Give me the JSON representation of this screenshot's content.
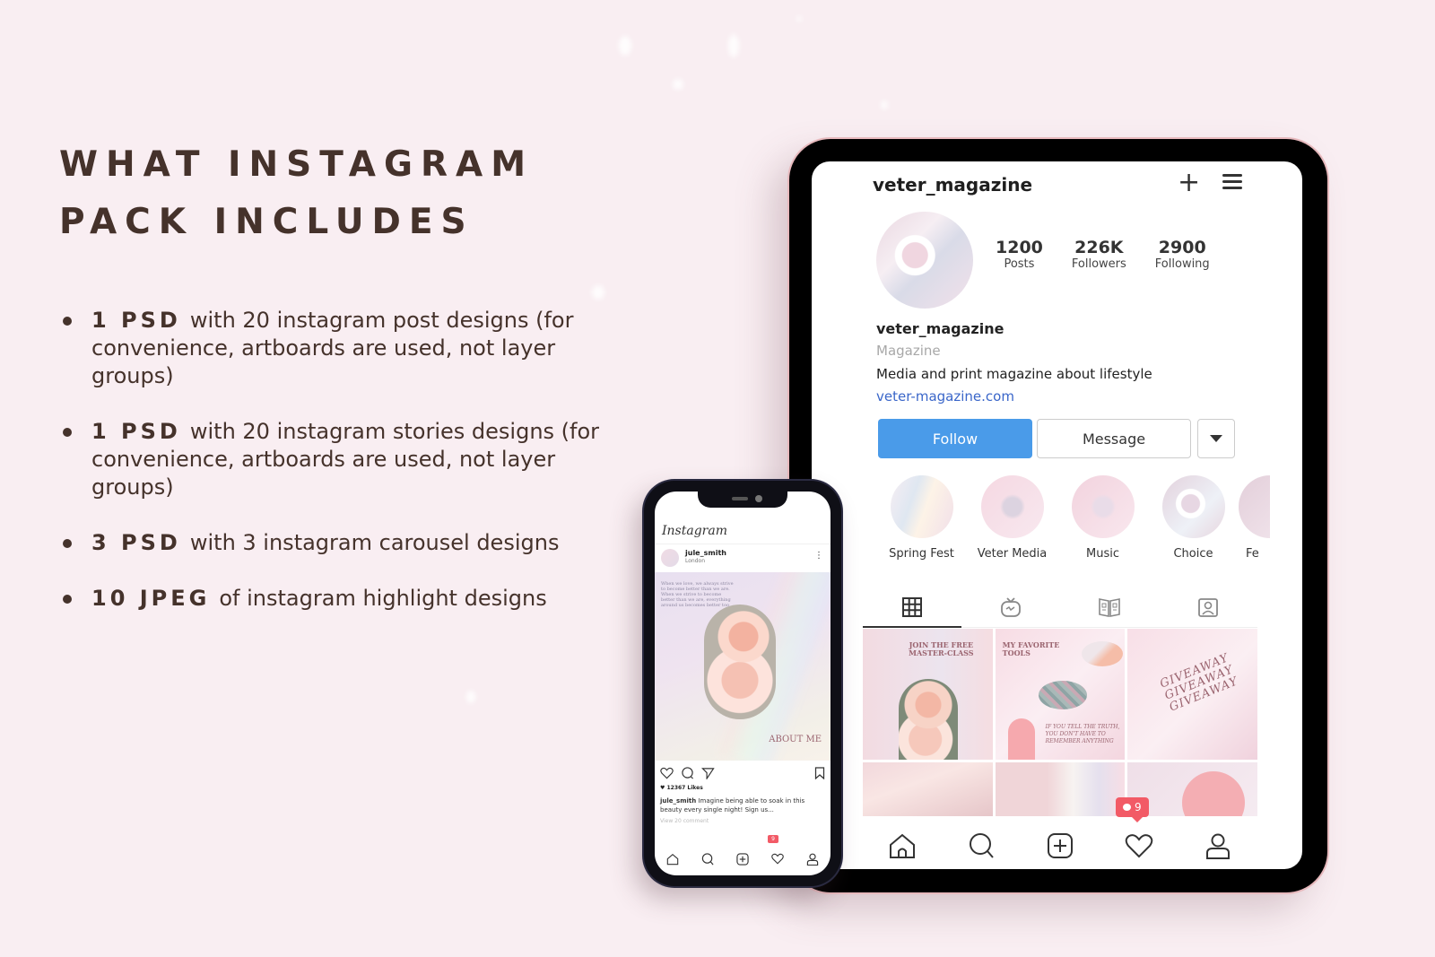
{
  "headline": {
    "line1": "WHAT INSTAGRAM",
    "line2": "PACK INCLUDES"
  },
  "features": [
    {
      "qty": "1 PSD",
      "desc": "with 20 instagram post designs (for convenience, artboards are used, not layer groups)"
    },
    {
      "qty": "1 PSD",
      "desc": "with 20 instagram stories designs (for convenience, artboards are used, not layer groups)"
    },
    {
      "qty": "3 PSD",
      "desc": "with 3 instagram carousel designs"
    },
    {
      "qty": "10 JPEG",
      "desc": "of instagram highlight designs"
    }
  ],
  "tablet": {
    "username": "veter_magazine",
    "icons": {
      "add": "plus-icon",
      "menu": "hamburger-menu-icon"
    },
    "stats": [
      {
        "value": "1200",
        "label": "Posts"
      },
      {
        "value": "226K",
        "label": "Followers"
      },
      {
        "value": "2900",
        "label": "Following"
      }
    ],
    "profile": {
      "name": "veter_magazine",
      "category": "Magazine",
      "bio": "Media and print magazine about lifestyle",
      "link": "veter-magazine.com"
    },
    "buttons": {
      "follow": "Follow",
      "message": "Message"
    },
    "highlights": [
      "Spring Fest",
      "Veter Media",
      "Music",
      "Choice",
      "Fe"
    ],
    "tabs": [
      "grid-icon",
      "igtv-icon",
      "guides-icon",
      "tagged-icon"
    ],
    "posts": {
      "p0_title": "JOIN THE FREE MASTER-CLASS",
      "p1_title": "MY FAVORITE TOOLS",
      "p1_quote": "IF YOU TELL THE TRUTH, YOU DON'T HAVE TO REMEMBER ANYTHING",
      "p2_text": "GIVEAWAY GIVEAWAY GIVEAWAY"
    },
    "notification_count": "9",
    "nav": [
      "home-icon",
      "search-icon",
      "add-post-icon",
      "activity-heart-icon",
      "profile-icon"
    ]
  },
  "phone": {
    "app_name": "Instagram",
    "post_user": "jule_smith",
    "post_location": "London",
    "post_text": "When we love, we always strive to become better than we are. When we strive to become better than we are, everything around us becomes better too",
    "post_title": "ABOUT ME",
    "likes": "12367 Likes",
    "caption_user": "jule_smith",
    "caption": "Imagine being able to soak in this beauty every single night! Sign us...",
    "view_comments": "View 20 comment",
    "notification_count": "9"
  },
  "colors": {
    "background": "#f9eef2",
    "text": "#45322b",
    "follow_button": "#4a9be9",
    "link": "#3a66c9",
    "notification": "#f25a66"
  }
}
